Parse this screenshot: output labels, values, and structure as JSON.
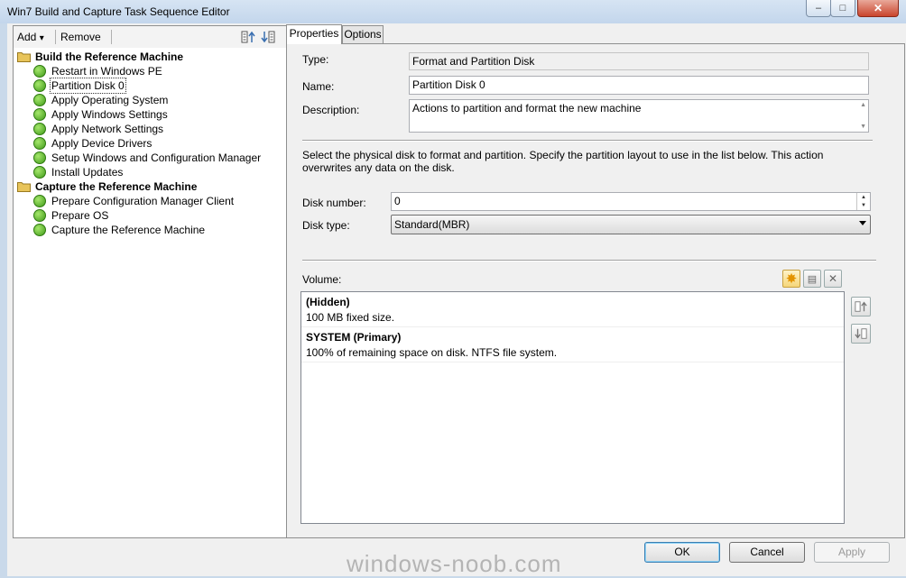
{
  "window": {
    "title": "Win7 Build and Capture Task Sequence Editor",
    "minimize_glyph": "‒",
    "maximize_glyph": "□"
  },
  "toolbar": {
    "add_label": "Add",
    "add_arrow": "▾",
    "remove_label": "Remove"
  },
  "tree": {
    "groups": [
      {
        "label": "Build the Reference Machine",
        "steps": [
          "Restart in Windows PE",
          "Partition Disk 0",
          "Apply Operating System",
          "Apply Windows Settings",
          "Apply Network Settings",
          "Apply Device Drivers",
          "Setup Windows and Configuration Manager",
          "Install Updates"
        ]
      },
      {
        "label": "Capture the Reference Machine",
        "steps": [
          "Prepare Configuration Manager Client",
          "Prepare OS",
          "Capture the Reference Machine"
        ]
      }
    ],
    "selected_step": "Partition Disk 0"
  },
  "tabs": [
    "Properties",
    "Options"
  ],
  "properties": {
    "type_label": "Type:",
    "type_value": "Format and Partition Disk",
    "name_label": "Name:",
    "name_value": "Partition Disk 0",
    "description_label": "Description:",
    "description_value": "Actions to partition and format the new machine",
    "info_text": "Select the physical disk to format and partition. Specify the partition layout to use in the list below. This action overwrites any data on the disk.",
    "disk_number_label": "Disk number:",
    "disk_number_value": "0",
    "disk_type_label": "Disk type:",
    "disk_type_value": "Standard(MBR)",
    "volume_label": "Volume:",
    "volumes": [
      {
        "name": "(Hidden)",
        "desc": "100 MB fixed size."
      },
      {
        "name": "SYSTEM (Primary)",
        "desc": "100% of remaining space on disk. NTFS file system."
      }
    ]
  },
  "buttons": {
    "ok": "OK",
    "cancel": "Cancel",
    "apply": "Apply"
  },
  "watermark": "windows-noob.com",
  "colors": {
    "check_green": "#3f9a19",
    "folder_yellow": "#e8c45a",
    "new_icon": "#f2a900"
  }
}
